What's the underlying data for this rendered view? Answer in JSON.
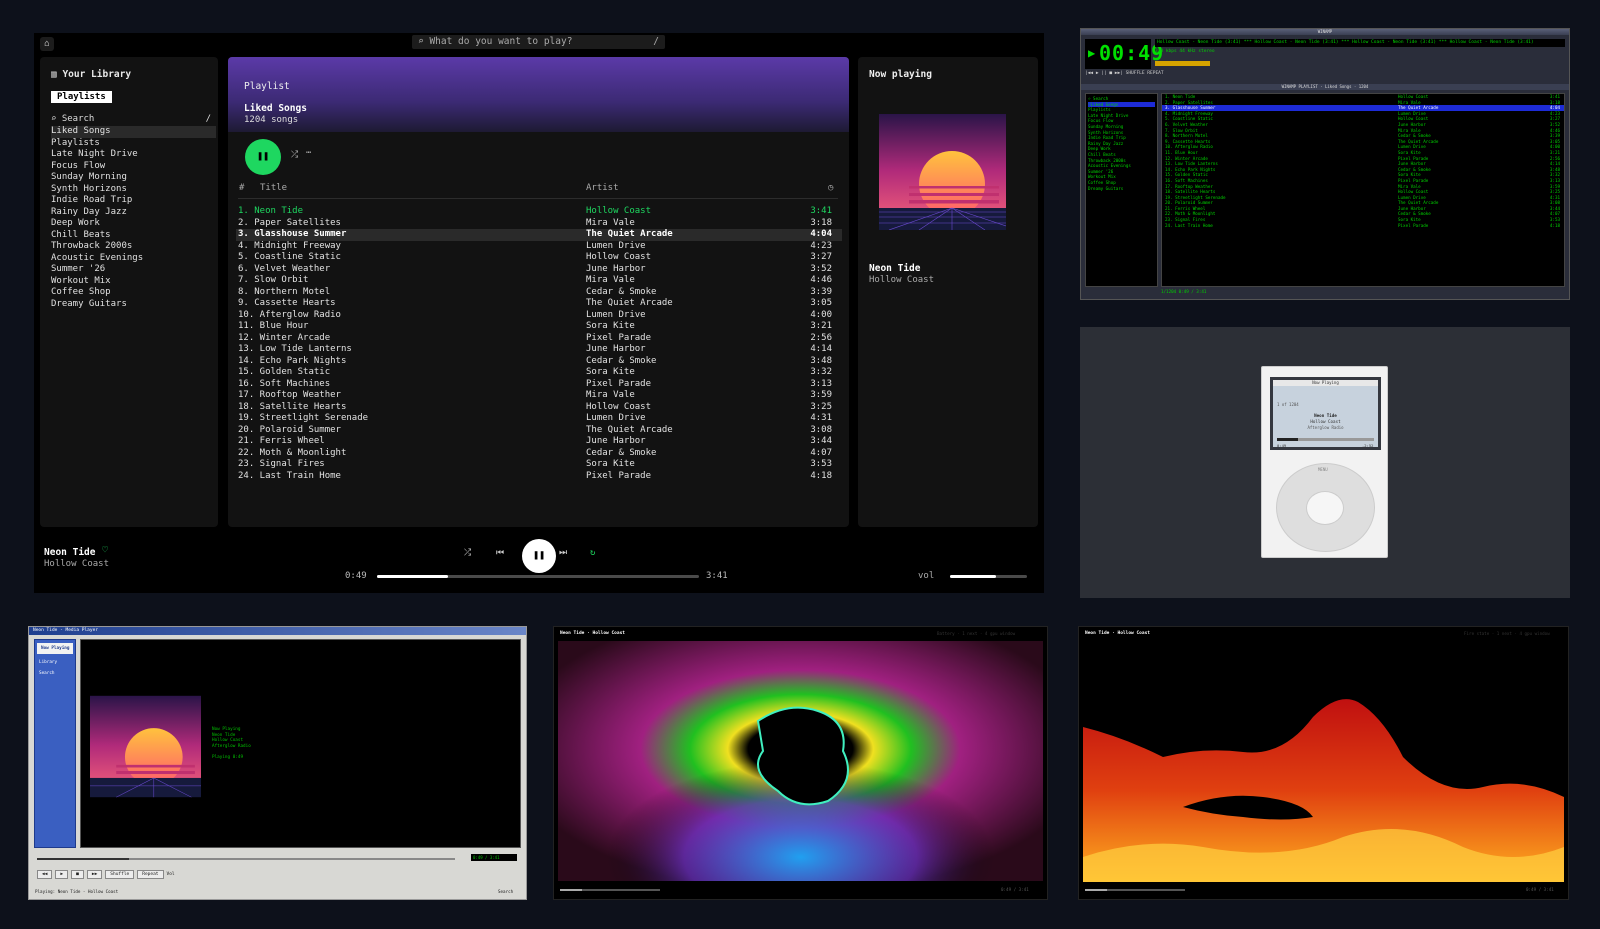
{
  "app": {
    "search_placeholder": "What do you want to play?",
    "search_shortcut": "/",
    "library": {
      "title": "Your Library",
      "chip": "Playlists",
      "search": "Search",
      "search_shortcut": "/",
      "items": [
        "Liked Songs",
        "Playlists",
        "Late Night Drive",
        "Focus Flow",
        "Sunday Morning",
        "Synth Horizons",
        "Indie Road Trip",
        "Rainy Day Jazz",
        "Deep Work",
        "Chill Beats",
        "Throwback 2000s",
        "Acoustic Evenings",
        "Summer '26",
        "Workout Mix",
        "Coffee Shop",
        "Dreamy Guitars"
      ]
    },
    "playlist": {
      "kind": "Playlist",
      "name": "Liked Songs",
      "count": "1204 songs",
      "columns": {
        "num": "#",
        "title": "Title",
        "artist": "Artist",
        "dur": "◷"
      },
      "tracks": [
        {
          "title": "1. Neon Tide",
          "artist": "Hollow Coast",
          "dur": "3:41"
        },
        {
          "title": "2. Paper Satellites",
          "artist": "Mira Vale",
          "dur": "3:18"
        },
        {
          "title": "3. Glasshouse Summer",
          "artist": "The Quiet Arcade",
          "dur": "4:04"
        },
        {
          "title": "4. Midnight Freeway",
          "artist": "Lumen Drive",
          "dur": "4:23"
        },
        {
          "title": "5. Coastline Static",
          "artist": "Hollow Coast",
          "dur": "3:27"
        },
        {
          "title": "6. Velvet Weather",
          "artist": "June Harbor",
          "dur": "3:52"
        },
        {
          "title": "7. Slow Orbit",
          "artist": "Mira Vale",
          "dur": "4:46"
        },
        {
          "title": "8. Northern Motel",
          "artist": "Cedar & Smoke",
          "dur": "3:39"
        },
        {
          "title": "9. Cassette Hearts",
          "artist": "The Quiet Arcade",
          "dur": "3:05"
        },
        {
          "title": "10. Afterglow Radio",
          "artist": "Lumen Drive",
          "dur": "4:00"
        },
        {
          "title": "11. Blue Hour",
          "artist": "Sora Kite",
          "dur": "3:21"
        },
        {
          "title": "12. Winter Arcade",
          "artist": "Pixel Parade",
          "dur": "2:56"
        },
        {
          "title": "13. Low Tide Lanterns",
          "artist": "June Harbor",
          "dur": "4:14"
        },
        {
          "title": "14. Echo Park Nights",
          "artist": "Cedar & Smoke",
          "dur": "3:48"
        },
        {
          "title": "15. Golden Static",
          "artist": "Sora Kite",
          "dur": "3:32"
        },
        {
          "title": "16. Soft Machines",
          "artist": "Pixel Parade",
          "dur": "3:13"
        },
        {
          "title": "17. Rooftop Weather",
          "artist": "Mira Vale",
          "dur": "3:59"
        },
        {
          "title": "18. Satellite Hearts",
          "artist": "Hollow Coast",
          "dur": "3:25"
        },
        {
          "title": "19. Streetlight Serenade",
          "artist": "Lumen Drive",
          "dur": "4:31"
        },
        {
          "title": "20. Polaroid Summer",
          "artist": "The Quiet Arcade",
          "dur": "3:08"
        },
        {
          "title": "21. Ferris Wheel",
          "artist": "June Harbor",
          "dur": "3:44"
        },
        {
          "title": "22. Moth & Moonlight",
          "artist": "Cedar & Smoke",
          "dur": "4:07"
        },
        {
          "title": "23. Signal Fires",
          "artist": "Sora Kite",
          "dur": "3:53"
        },
        {
          "title": "24. Last Train Home",
          "artist": "Pixel Parade",
          "dur": "4:18"
        }
      ]
    },
    "now_playing": {
      "header": "Now playing",
      "title": "Neon Tide",
      "artist": "Hollow Coast"
    },
    "player": {
      "title": "Neon Tide",
      "artist": "Hollow Coast",
      "current": "0:49",
      "total": "3:41",
      "progress": 0.22,
      "volume_label": "vol",
      "volume": 0.6
    }
  },
  "winamp": {
    "time": "00:49",
    "title": "WINAMP",
    "marquee": "Hollow Coast - Neon Tide (3:41) *** Hollow Coast - Neon Tide (3:41) *** Hollow Coast - Neon Tide (3:41) *** Hollow Coast - Neon Tide (3:41)",
    "info": "320 kbps  44 kHz   stereo",
    "buttons": "|◀◀  ▶  ||  ■  ▶▶|   SHUFFLE  REPEAT",
    "playlist_title": "WINAMP PLAYLIST · Liked Songs · 1204",
    "side": [
      "⌕ Search",
      "♡Liked Songs",
      "Playlists",
      "Late Night Drive",
      "Focus Flow",
      "Sunday Morning",
      "Synth Horizons",
      "Indie Road Trip",
      "Rainy Day Jazz",
      "Deep Work",
      "Chill Beats",
      "Throwback 2000s",
      "Acoustic Evenings",
      "Summer '26",
      "Workout Mix",
      "Coffee Shop",
      "Dreamy Guitars"
    ],
    "footer": "1/1204   0:49 / 3:41"
  },
  "ipod": {
    "bar": "Now Playing",
    "pos": "1 of 1204",
    "title": "Neon Tide",
    "artist": "Hollow Coast",
    "album": "Afterglow Radio",
    "cur": "0:49",
    "tot": "-2:52",
    "menu": "MENU",
    "progress": 0.22
  },
  "wmp": {
    "title": "Neon Tide - Media Player",
    "nav": [
      "Now Playing",
      "Library",
      "Search"
    ],
    "meta": [
      "Now Playing",
      "Neon Tide",
      "Hollow Coast",
      "Afterglow Radio",
      "",
      "Playing   0:49"
    ],
    "time": "0:49 / 3:41",
    "controls": [
      "◀◀",
      "▶",
      "■",
      "▶▶",
      "Shuffle",
      "Repeat"
    ],
    "vol": "Vol",
    "status": "Playing: Neon Tide - Hollow Coast",
    "status_right": "Search"
  },
  "viz1": {
    "title": "Neon Tide · Hollow Coast",
    "right": "Battery · 1 next · 4 gpu window",
    "time": "0:49 / 3:41",
    "progress": 0.22
  },
  "viz2": {
    "title": "Neon Tide · Hollow Coast",
    "right": "Fire state · 1 next · 4 gpu window",
    "time": "0:49 / 3:41",
    "progress": 0.22
  },
  "colors": {
    "accent": "#1ed760",
    "winamp_green": "#00d000",
    "winamp_select": "#1d2bd6"
  }
}
